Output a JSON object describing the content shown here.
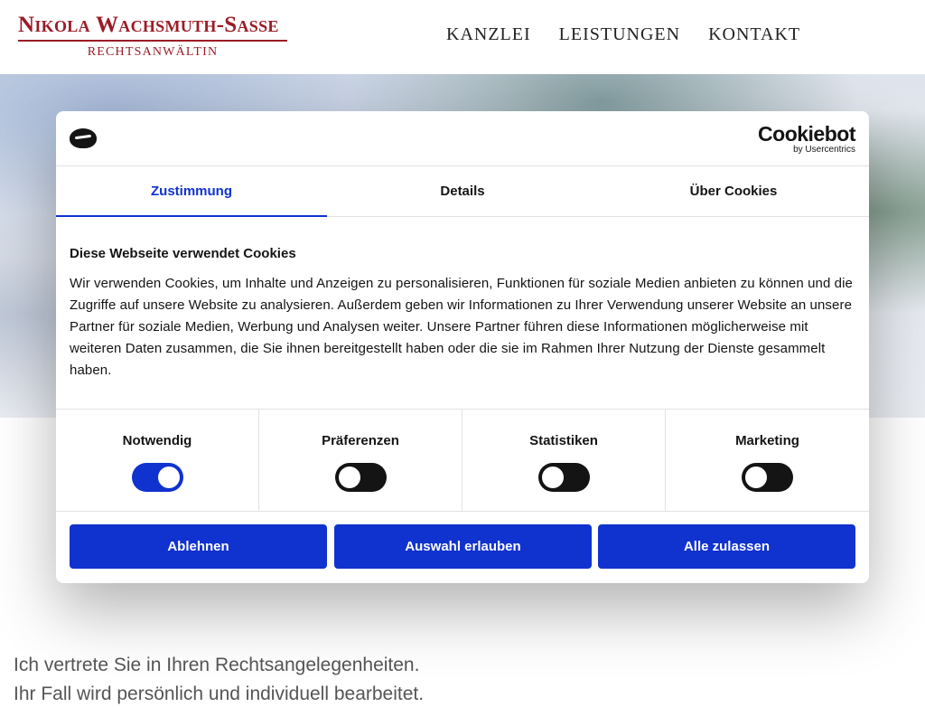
{
  "header": {
    "logo_name": "Nikola Wachsmuth-Sasse",
    "logo_subtitle": "RECHTSANWÄLTIN",
    "nav": [
      "KANZLEI",
      "LEISTUNGEN",
      "KONTAKT"
    ]
  },
  "intro": {
    "headline": "Ich vertrete Sie in Ihren Rechtsangelegenheiten.",
    "subline": "Ihr Fall wird persönlich und individuell bearbeitet."
  },
  "cookie_dialog": {
    "brand": "Cookiebot",
    "brand_sub": "by Usercentrics",
    "tabs": [
      {
        "label": "Zustimmung",
        "active": true
      },
      {
        "label": "Details",
        "active": false
      },
      {
        "label": "Über Cookies",
        "active": false
      }
    ],
    "title": "Diese Webseite verwendet Cookies",
    "text": "Wir verwenden Cookies, um Inhalte und Anzeigen zu personalisieren, Funktionen für soziale Medien anbieten zu können und die Zugriffe auf unsere Website zu analysieren. Außerdem geben wir Informationen zu Ihrer Verwendung unserer Website an unsere Partner für soziale Medien, Werbung und Analysen weiter. Unsere Partner führen diese Informationen möglicherweise mit weiteren Daten zusammen, die Sie ihnen bereitgestellt haben oder die sie im Rahmen Ihrer Nutzung der Dienste gesammelt haben.",
    "toggles": [
      {
        "label": "Notwendig",
        "on": true
      },
      {
        "label": "Präferenzen",
        "on": false
      },
      {
        "label": "Statistiken",
        "on": false
      },
      {
        "label": "Marketing",
        "on": false
      }
    ],
    "buttons": {
      "decline": "Ablehnen",
      "allow_selection": "Auswahl erlauben",
      "allow_all": "Alle zulassen"
    },
    "colors": {
      "accent": "#1032cf",
      "text": "#141414",
      "brand_red": "#9b1c26"
    }
  }
}
